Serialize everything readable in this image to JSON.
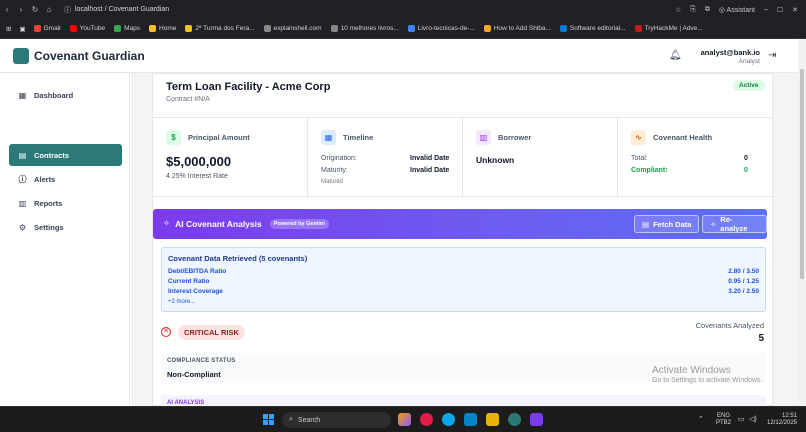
{
  "browser": {
    "url": "localhost / Covenant Guardian",
    "assistant_label": "Assistant",
    "bookmarks": [
      {
        "label": "Gmail",
        "color": "#ea4335"
      },
      {
        "label": "YouTube",
        "color": "#ff0000"
      },
      {
        "label": "Maps",
        "color": "#34a853"
      },
      {
        "label": "Home",
        "color": "#f6c026"
      },
      {
        "label": "2ª Turma dos Fera...",
        "color": "#f6c026"
      },
      {
        "label": "explainshell.com",
        "color": "#888888"
      },
      {
        "label": "10 melhores livros...",
        "color": "#888888"
      },
      {
        "label": "Livro-tecnicas-de-...",
        "color": "#4285f4"
      },
      {
        "label": "How to Add Shiba...",
        "color": "#f6a623"
      },
      {
        "label": "Software editorial...",
        "color": "#0078d4"
      },
      {
        "label": "TryHackMe | Adve...",
        "color": "#c11b1b"
      }
    ]
  },
  "app": {
    "name": "Covenant Guardian",
    "brand_color": "#2b7a78",
    "user": {
      "email": "analyst@bank.io",
      "role": "Analyst"
    }
  },
  "sidebar": {
    "items": [
      {
        "label": "Dashboard",
        "icon": "dashboard-icon",
        "active": false
      },
      {
        "label": "Contracts",
        "icon": "document-icon",
        "active": true
      },
      {
        "label": "Alerts",
        "icon": "alert-icon",
        "active": false
      },
      {
        "label": "Reports",
        "icon": "bar-chart-icon",
        "active": false
      },
      {
        "label": "Settings",
        "icon": "gear-icon",
        "active": false
      }
    ]
  },
  "contract": {
    "title": "Term Loan Facility - Acme Corp",
    "number": "Contract #N/A",
    "status": "Active"
  },
  "stats": {
    "principal": {
      "label": "Principal Amount",
      "value": "$5,000,000",
      "note": "4.25% Interest Rate"
    },
    "timeline": {
      "label": "Timeline",
      "origination_label": "Origination:",
      "origination_value": "Invalid Date",
      "maturity_label": "Maturity:",
      "maturity_value": "Invalid Date",
      "state": "Matured"
    },
    "borrower": {
      "label": "Borrower",
      "value": "Unknown"
    },
    "health": {
      "label": "Covenant Health",
      "total_label": "Total:",
      "total_value": "0",
      "compliant_label": "Compliant:",
      "compliant_value": "0"
    }
  },
  "ai": {
    "title": "AI Covenant Analysis",
    "powered_by": "Powered by Gemini",
    "fetch_label": "Fetch Data",
    "reanalyze_label": "Re-analyze",
    "retrieved_title": "Covenant Data Retrieved (5 covenants)",
    "covenants": [
      {
        "name": "Debt/EBITDA Ratio",
        "value": "2.80 / 3.50"
      },
      {
        "name": "Current Ratio",
        "value": "0.95 / 1.25"
      },
      {
        "name": "Interest Coverage",
        "value": "3.20 / 2.50"
      }
    ],
    "more_link": "+2 more...",
    "risk_label": "CRITICAL RISK",
    "analyzed_label": "Covenants Analyzed",
    "analyzed_value": "5",
    "compliance_label": "COMPLIANCE STATUS",
    "compliance_value": "Non-Compliant",
    "analysis_label": "AI ANALYSIS"
  },
  "watermark": {
    "line1": "Activate Windows",
    "line2": "Go to Settings to activate Windows."
  },
  "taskbar": {
    "search_placeholder": "Search",
    "lang_line1": "ENG",
    "lang_line2": "PTB2",
    "time": "12:51",
    "date": "12/12/2025"
  }
}
